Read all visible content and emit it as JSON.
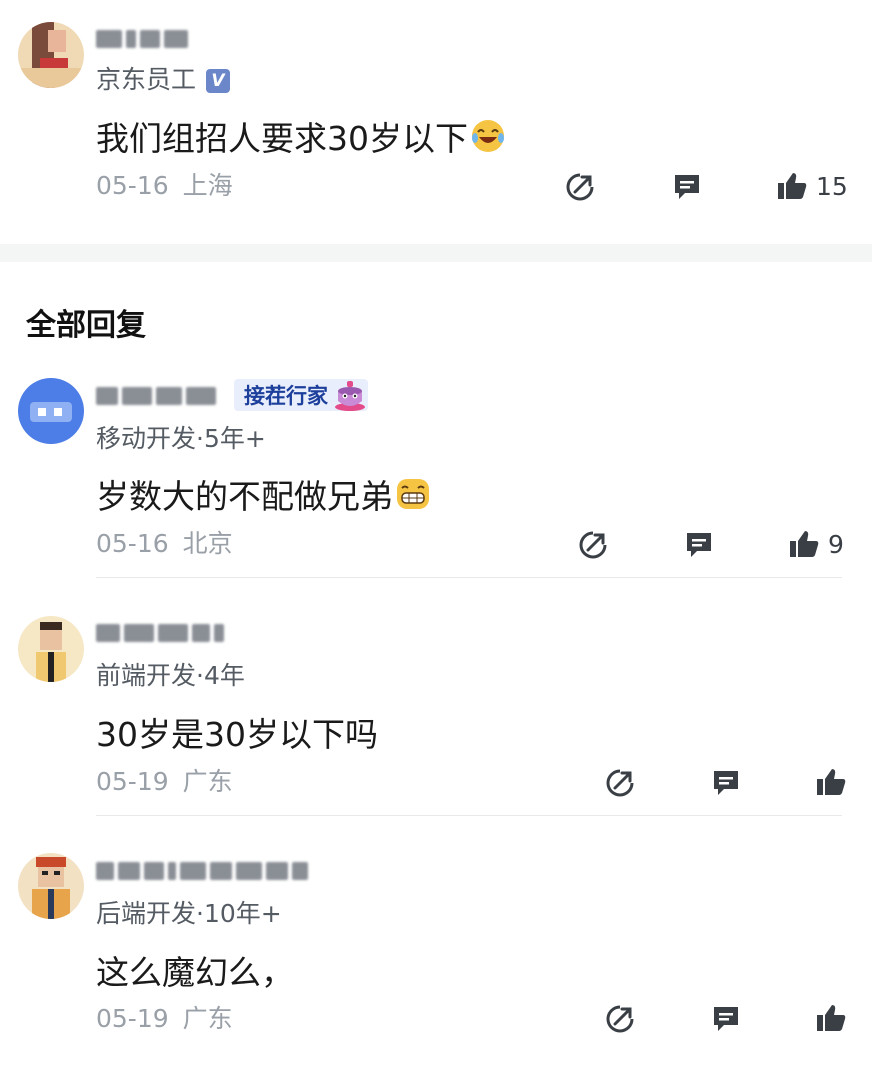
{
  "post": {
    "author_role": "京东员工",
    "content": "我们组招人要求30岁以下",
    "date": "05-16",
    "location": "上海",
    "like_count": "15"
  },
  "section": {
    "title": "全部回复"
  },
  "replies": [
    {
      "author_badge": "接茬行家",
      "author_role": "移动开发·5年+",
      "content": "岁数大的不配做兄弟",
      "date": "05-16",
      "location": "北京",
      "like_count": "9"
    },
    {
      "author_role": "前端开发·4年",
      "content": "30岁是30岁以下吗",
      "date": "05-19",
      "location": "广东",
      "like_count": ""
    },
    {
      "author_role": "后端开发·10年+",
      "content": "这么魔幻么，",
      "date": "05-19",
      "location": "广东",
      "like_count": ""
    }
  ],
  "icons": {
    "share": "share-icon",
    "comment": "comment-icon",
    "like": "thumbs-up-icon"
  },
  "colors": {
    "background": "#ffffff",
    "divider": "#f4f5f5",
    "meta_text": "#9aa0a8",
    "badge_bg": "#e9eefc",
    "badge_text": "#1d3f9c",
    "verified": "#6b86c9"
  }
}
